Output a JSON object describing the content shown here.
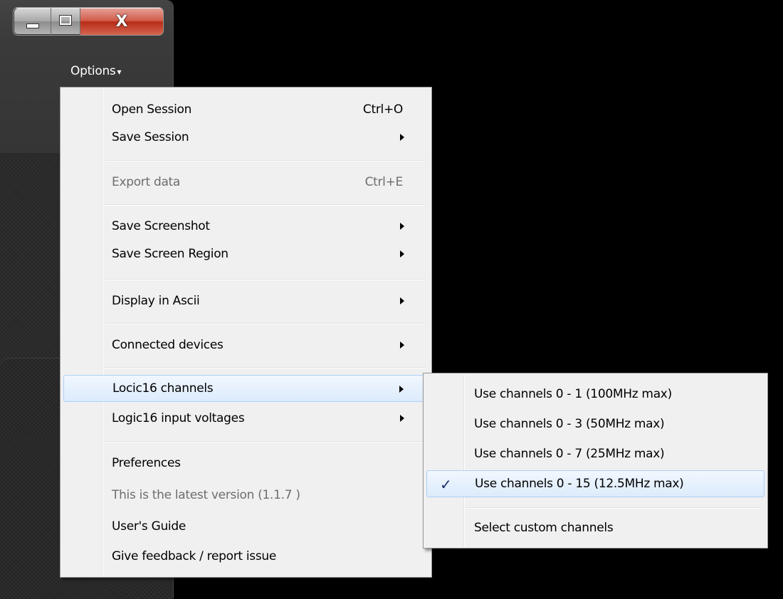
{
  "window": {
    "caption_buttons": {
      "minimize": "minimize-icon",
      "maximize": "maximize-icon",
      "close": "close-icon",
      "close_glyph": "X"
    },
    "options_label": "Options",
    "options_caret": "▾"
  },
  "main_menu": {
    "items": [
      {
        "label": "Open Session",
        "shortcut": "Ctrl+O"
      },
      {
        "label": "Save Session"
      },
      {
        "label": "Export data",
        "shortcut": "Ctrl+E"
      },
      {
        "label": "Save Screenshot"
      },
      {
        "label": "Save Screen Region"
      },
      {
        "label": "Display in Ascii"
      },
      {
        "label": "Connected devices"
      },
      {
        "label": "Locic16 channels"
      },
      {
        "label": "Logic16 input voltages"
      },
      {
        "label": "Preferences"
      },
      {
        "label": "This is the latest version (1.1.7 )"
      },
      {
        "label": "User's Guide"
      },
      {
        "label": "Give feedback / report issue"
      }
    ]
  },
  "sub_menu": {
    "items": [
      {
        "label": "Use channels 0 - 1  (100MHz max)"
      },
      {
        "label": "Use channels 0 - 3  (50MHz max)"
      },
      {
        "label": "Use channels 0 - 7  (25MHz max)"
      },
      {
        "label": "Use channels 0 - 15 (12.5MHz max)",
        "check": "✓"
      },
      {
        "label": "Select custom channels"
      }
    ]
  },
  "colors": {
    "menu_bg": "#f0f0f0",
    "highlight_border": "#aecff7",
    "disabled_text": "#6d6d6d",
    "app_bg": "#2b2b2b"
  }
}
